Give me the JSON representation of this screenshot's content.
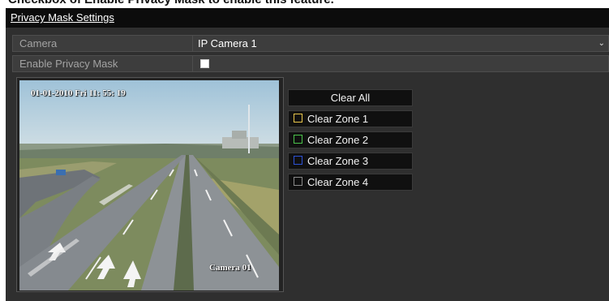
{
  "caption": "Checkbox of Enable Privacy Mask to enable this feature.",
  "window": {
    "title": "Privacy Mask Settings"
  },
  "form": {
    "camera": {
      "label": "Camera",
      "value": "IP Camera 1",
      "icon": "chevron-down-icon"
    },
    "enable_privacy_mask": {
      "label": "Enable Privacy Mask",
      "checked": false
    }
  },
  "preview": {
    "timestamp": "01-01-2010  Fri  11: 55: 19",
    "camera_name": "Camera 01"
  },
  "buttons": {
    "clear_all": "Clear All",
    "zones": [
      {
        "label": "Clear Zone 1",
        "color": "#e8c64a"
      },
      {
        "label": "Clear Zone 2",
        "color": "#4bc34b"
      },
      {
        "label": "Clear Zone 3",
        "color": "#2c52d6"
      },
      {
        "label": "Clear Zone 4",
        "color": "#8a8a8a"
      }
    ]
  },
  "colors": {
    "panel_bg": "#2f2f2f",
    "title_bar_bg": "#0c0c0c",
    "button_bg": "#101010",
    "text": "#ffffff",
    "label_text": "#a3a3a3"
  }
}
